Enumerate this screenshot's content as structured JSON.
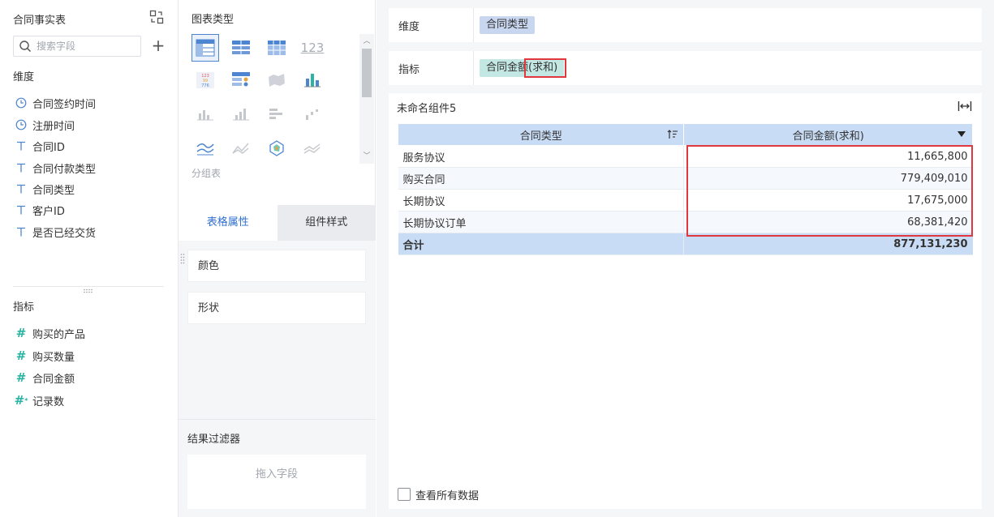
{
  "data_panel": {
    "title": "合同事实表",
    "search": {
      "placeholder": "搜索字段",
      "value": ""
    },
    "dimension_title": "维度",
    "dimensions": [
      {
        "label": "合同签约时间",
        "icon": "clock-icon"
      },
      {
        "label": "注册时间",
        "icon": "clock-icon"
      },
      {
        "label": "合同ID",
        "icon": "text-type-icon"
      },
      {
        "label": "合同付款类型",
        "icon": "text-type-icon"
      },
      {
        "label": "合同类型",
        "icon": "text-type-icon"
      },
      {
        "label": "客户ID",
        "icon": "text-type-icon"
      },
      {
        "label": "是否已经交货",
        "icon": "text-type-icon"
      }
    ],
    "metric_title": "指标",
    "metrics": [
      {
        "label": "购买的产品",
        "icon": "number-hash-icon"
      },
      {
        "label": "购买数量",
        "icon": "number-hash-icon"
      },
      {
        "label": "合同金额",
        "icon": "number-hash-icon"
      },
      {
        "label": "记录数",
        "icon": "calc-hash-icon"
      }
    ]
  },
  "chart_panel": {
    "title": "图表类型",
    "selected_label": "分组表",
    "tabs": {
      "table_props": "表格属性",
      "component_style": "组件样式"
    },
    "props": {
      "color": "颜色",
      "shape": "形状"
    },
    "filter": {
      "title": "结果过滤器",
      "drop_hint": "拖入字段"
    }
  },
  "shelves": {
    "dimension_label": "维度",
    "dimension_pill": "合同类型",
    "metric_label": "指标",
    "metric_pill": "合同金额(求和)"
  },
  "widget": {
    "title": "未命名组件5",
    "columns": [
      "合同类型",
      "合同金额(求和)"
    ],
    "rows": [
      {
        "type": "服务协议",
        "amount": "11,665,800"
      },
      {
        "type": "购买合同",
        "amount": "779,409,010"
      },
      {
        "type": "长期协议",
        "amount": "17,675,000"
      },
      {
        "type": "长期协议订单",
        "amount": "68,381,420"
      }
    ],
    "total": {
      "label": "合计",
      "amount": "877,131,230"
    },
    "view_all_label": "查看所有数据"
  },
  "colors": {
    "accent_blue": "#2f6fd0",
    "header_blue": "#c9dcf5",
    "dimension_pill": "#c9d6ef",
    "metric_pill": "#c3e7e3",
    "highlight_red": "#e0383e",
    "field_icon": "#2bb3a3"
  }
}
